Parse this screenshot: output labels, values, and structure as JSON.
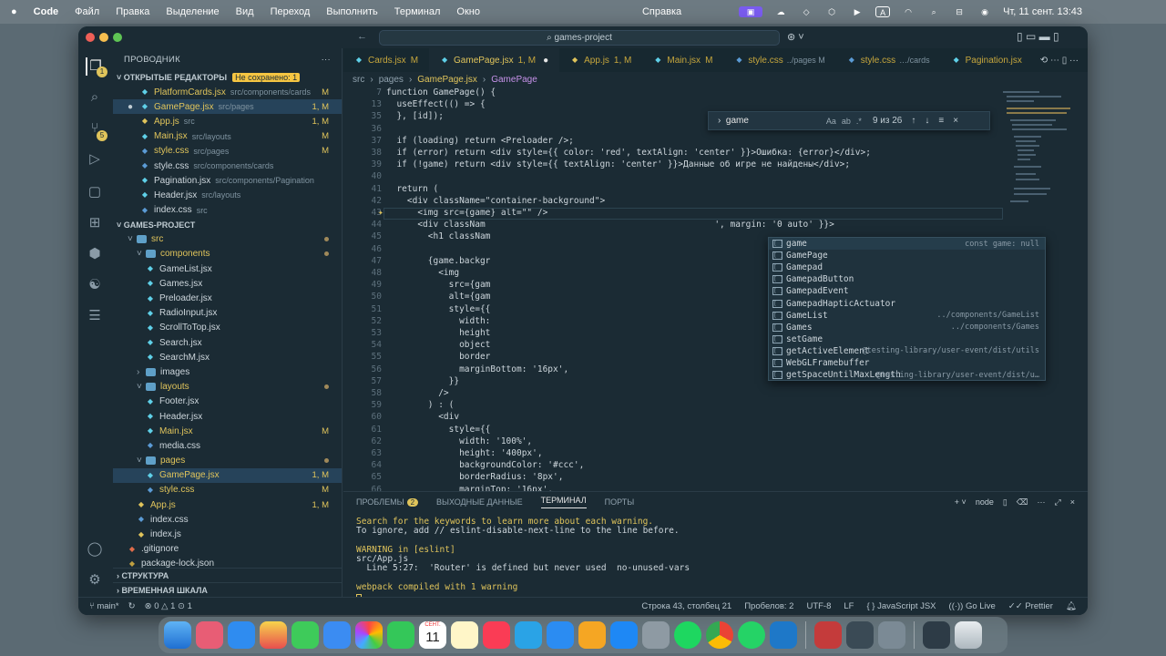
{
  "menubar": {
    "apple": "",
    "app": "Code",
    "items": [
      "Файл",
      "Правка",
      "Выделение",
      "Вид",
      "Переход",
      "Выполнить",
      "Терминал",
      "Окно"
    ],
    "help": "Справка",
    "datetime": "Чт, 11 сент.  13:43"
  },
  "window": {
    "search": "games-project"
  },
  "sidebar": {
    "title": "ПРОВОДНИК",
    "open_editors_label": "ОТКРЫТЫЕ РЕДАКТОРЫ",
    "unsaved_label": "Не сохранено: 1",
    "open_editors": [
      {
        "name": "PlatformCards.jsx",
        "path": "src/components/cards",
        "mark": "M"
      },
      {
        "name": "GamePage.jsx",
        "path": "src/pages",
        "mark": "1, M"
      },
      {
        "name": "App.js",
        "path": "src",
        "mark": "1, M"
      },
      {
        "name": "Main.jsx",
        "path": "src/layouts",
        "mark": "M"
      },
      {
        "name": "style.css",
        "path": "src/pages",
        "mark": "M"
      },
      {
        "name": "style.css",
        "path": "src/components/cards",
        "mark": ""
      },
      {
        "name": "Pagination.jsx",
        "path": "src/components/Pagination",
        "mark": ""
      },
      {
        "name": "Header.jsx",
        "path": "src/layouts",
        "mark": ""
      },
      {
        "name": "index.css",
        "path": "src",
        "mark": ""
      }
    ],
    "project_label": "GAMES-PROJECT",
    "tree": [
      {
        "name": "src",
        "type": "folder",
        "mark": "dot"
      },
      {
        "name": "components",
        "type": "folder",
        "mark": "dot"
      },
      {
        "name": "GameList.jsx",
        "type": "file",
        "mark": ""
      },
      {
        "name": "Games.jsx",
        "type": "file",
        "mark": ""
      },
      {
        "name": "Preloader.jsx",
        "type": "file",
        "mark": ""
      },
      {
        "name": "RadioInput.jsx",
        "type": "file",
        "mark": ""
      },
      {
        "name": "ScrollToTop.jsx",
        "type": "file",
        "mark": ""
      },
      {
        "name": "Search.jsx",
        "type": "file",
        "mark": ""
      },
      {
        "name": "SearchM.jsx",
        "type": "file",
        "mark": ""
      },
      {
        "name": "images",
        "type": "folder",
        "mark": ""
      },
      {
        "name": "layouts",
        "type": "folder",
        "mark": "dot"
      },
      {
        "name": "Footer.jsx",
        "type": "file",
        "mark": ""
      },
      {
        "name": "Header.jsx",
        "type": "file",
        "mark": ""
      },
      {
        "name": "Main.jsx",
        "type": "file",
        "mark": "M"
      },
      {
        "name": "media.css",
        "type": "file",
        "mark": ""
      },
      {
        "name": "pages",
        "type": "folder",
        "mark": "dot"
      },
      {
        "name": "GamePage.jsx",
        "type": "file",
        "mark": "1, M"
      },
      {
        "name": "style.css",
        "type": "file",
        "mark": "M"
      },
      {
        "name": "App.js",
        "type": "file",
        "mark": "1, M"
      },
      {
        "name": "index.css",
        "type": "file",
        "mark": ""
      },
      {
        "name": "index.js",
        "type": "file",
        "mark": ""
      },
      {
        "name": ".gitignore",
        "type": "file",
        "mark": ""
      },
      {
        "name": "package-lock.json",
        "type": "file",
        "mark": ""
      }
    ],
    "outline_label": "СТРУКТУРА",
    "timeline_label": "ВРЕМЕННАЯ ШКАЛА"
  },
  "tabs": [
    {
      "name": "Cards.jsx",
      "mark": "M",
      "sub": ""
    },
    {
      "name": "GamePage.jsx",
      "mark": "1, M",
      "sub": ""
    },
    {
      "name": "App.js",
      "mark": "1, M",
      "sub": ""
    },
    {
      "name": "Main.jsx",
      "mark": "M",
      "sub": ""
    },
    {
      "name": "style.css",
      "mark": "",
      "sub": "../pages M"
    },
    {
      "name": "style.css",
      "mark": "",
      "sub": "…/cards"
    },
    {
      "name": "Pagination.jsx",
      "mark": "",
      "sub": ""
    }
  ],
  "breadcrumb": [
    "src",
    "pages",
    "GamePage.jsx",
    "GamePage"
  ],
  "find": {
    "query": "game",
    "opts": [
      "Aa",
      "ab",
      ".*"
    ],
    "count": "9 из 26"
  },
  "code_lines": [
    {
      "n": "7",
      "t": "function GamePage() {"
    },
    {
      "n": "13",
      "t": "  useEffect(() => {"
    },
    {
      "n": "35",
      "t": "  }, [id]);"
    },
    {
      "n": "36",
      "t": ""
    },
    {
      "n": "37",
      "t": "  if (loading) return <Preloader />;"
    },
    {
      "n": "38",
      "t": "  if (error) return <div style={{ color: 'red', textAlign: 'center' }}>Ошибка: {error}</div>;"
    },
    {
      "n": "39",
      "t": "  if (!game) return <div style={{ textAlign: 'center' }}>Данные об игре не найдены</div>;"
    },
    {
      "n": "40",
      "t": ""
    },
    {
      "n": "41",
      "t": "  return ("
    },
    {
      "n": "42",
      "t": "    <div className=\"container-background\">"
    },
    {
      "n": "43",
      "t": "      <img src={game} alt=\"\" />"
    },
    {
      "n": "44",
      "t": "      <div classNam                                            ', margin: '0 auto' }}>"
    },
    {
      "n": "45",
      "t": "        <h1 classNam"
    },
    {
      "n": "46",
      "t": ""
    },
    {
      "n": "47",
      "t": "        {game.backgr"
    },
    {
      "n": "48",
      "t": "          <img"
    },
    {
      "n": "49",
      "t": "            src={gam"
    },
    {
      "n": "50",
      "t": "            alt={gam"
    },
    {
      "n": "51",
      "t": "            style={{"
    },
    {
      "n": "52",
      "t": "              width:"
    },
    {
      "n": "53",
      "t": "              height"
    },
    {
      "n": "54",
      "t": "              object"
    },
    {
      "n": "55",
      "t": "              border"
    },
    {
      "n": "56",
      "t": "              marginBottom: '16px',"
    },
    {
      "n": "57",
      "t": "            }}"
    },
    {
      "n": "58",
      "t": "          />"
    },
    {
      "n": "59",
      "t": "        ) : ("
    },
    {
      "n": "60",
      "t": "          <div"
    },
    {
      "n": "61",
      "t": "            style={{"
    },
    {
      "n": "62",
      "t": "              width: '100%',"
    },
    {
      "n": "63",
      "t": "              height: '400px',"
    },
    {
      "n": "64",
      "t": "              backgroundColor: '#ccc',"
    },
    {
      "n": "65",
      "t": "              borderRadius: '8px',"
    },
    {
      "n": "66",
      "t": "              marginTop: '16px',"
    }
  ],
  "suggestions": [
    {
      "label": "game",
      "detail": "const game: null"
    },
    {
      "label": "GamePage",
      "detail": ""
    },
    {
      "label": "Gamepad",
      "detail": ""
    },
    {
      "label": "GamepadButton",
      "detail": ""
    },
    {
      "label": "GamepadEvent",
      "detail": ""
    },
    {
      "label": "GamepadHapticActuator",
      "detail": ""
    },
    {
      "label": "GameList",
      "detail": "../components/GameList"
    },
    {
      "label": "Games",
      "detail": "../components/Games"
    },
    {
      "label": "setGame",
      "detail": ""
    },
    {
      "label": "getActiveElement",
      "detail": "@testing-library/user-event/dist/utils"
    },
    {
      "label": "WebGLFramebuffer",
      "detail": ""
    },
    {
      "label": "getSpaceUntilMaxLength",
      "detail": "@testing-library/user-event/dist/u…"
    }
  ],
  "panel": {
    "tabs": [
      "ПРОБЛЕМЫ",
      "ВЫХОДНЫЕ ДАННЫЕ",
      "ТЕРМИНАЛ",
      "ПОРТЫ"
    ],
    "problems_count": "2",
    "shell": "node",
    "terminal": [
      "Search for the keywords to learn more about each warning.",
      "To ignore, add // eslint-disable-next-line to the line before.",
      "",
      "WARNING in [eslint]",
      "src/App.js",
      "  Line 5:27:  'Router' is defined but never used  no-unused-vars",
      "",
      "webpack compiled with 1 warning"
    ]
  },
  "status": {
    "branch": "main*",
    "errors": "⊗ 0  △ 1  ⊙ 1",
    "position": "Строка 43, столбец 21",
    "spaces": "Пробелов: 2",
    "encoding": "UTF-8",
    "eol": "LF",
    "language": "JavaScript JSX",
    "golive": "Go Live",
    "prettier": "Prettier"
  },
  "dock": {
    "calendar_month": "СЕНТ.",
    "calendar_day": "11"
  }
}
